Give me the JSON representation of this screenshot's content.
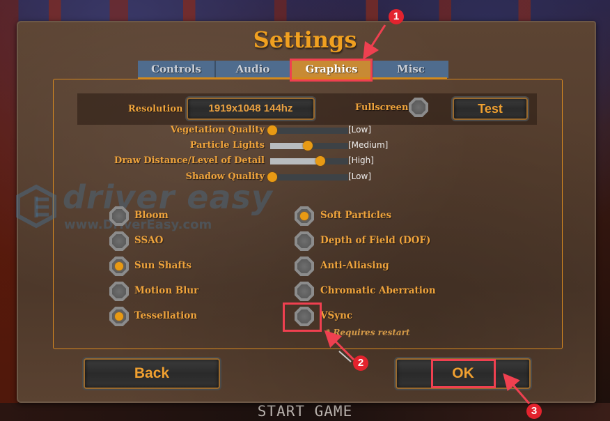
{
  "window": {
    "title": "Settings"
  },
  "tabs": [
    {
      "label": "Controls",
      "active": false
    },
    {
      "label": "Audio",
      "active": false
    },
    {
      "label": "Graphics",
      "active": true
    },
    {
      "label": "Misc",
      "active": false
    }
  ],
  "resolution": {
    "label": "Resolution",
    "value": "1919x1048  144hz",
    "fullscreen_label": "Fullscreen",
    "fullscreen_checked": false,
    "test_label": "Test"
  },
  "sliders": [
    {
      "label": "Vegetation Quality",
      "value_label": "[Low]",
      "fraction": 0.0
    },
    {
      "label": "Particle Lights",
      "value_label": "[Medium]",
      "fraction": 0.48
    },
    {
      "label": "Draw Distance/Level of Detail",
      "value_label": "[High]",
      "fraction": 0.64
    },
    {
      "label": "Shadow Quality",
      "value_label": "[Low]",
      "fraction": 0.0
    }
  ],
  "options_left": [
    {
      "label": "Bloom",
      "checked": false
    },
    {
      "label": "SSAO",
      "checked": false
    },
    {
      "label": "Sun Shafts",
      "checked": true
    },
    {
      "label": "Motion Blur",
      "checked": false
    },
    {
      "label": "Tessellation",
      "checked": true
    }
  ],
  "options_right": [
    {
      "label": "Soft Particles",
      "checked": true
    },
    {
      "label": "Depth of Field (DOF)",
      "checked": false
    },
    {
      "label": "Anti-Aliasing",
      "checked": false
    },
    {
      "label": "Chromatic Aberration",
      "checked": false
    },
    {
      "label": "VSync",
      "checked": false
    }
  ],
  "vsync_note": "* Requires restart",
  "buttons": {
    "back": "Back",
    "ok": "OK"
  },
  "background": {
    "start_game": "START GAME"
  },
  "watermark": {
    "brand": "driver easy",
    "url": "www.DriverEasy.com"
  },
  "annotations": [
    {
      "number": "1",
      "target": "Graphics tab"
    },
    {
      "number": "2",
      "target": "VSync checkbox"
    },
    {
      "number": "3",
      "target": "OK button"
    }
  ],
  "colors": {
    "accent": "#f0a020",
    "tab_inactive": "#4f6c8e",
    "tab_active": "#c88a34",
    "highlight": "#ef4050"
  }
}
